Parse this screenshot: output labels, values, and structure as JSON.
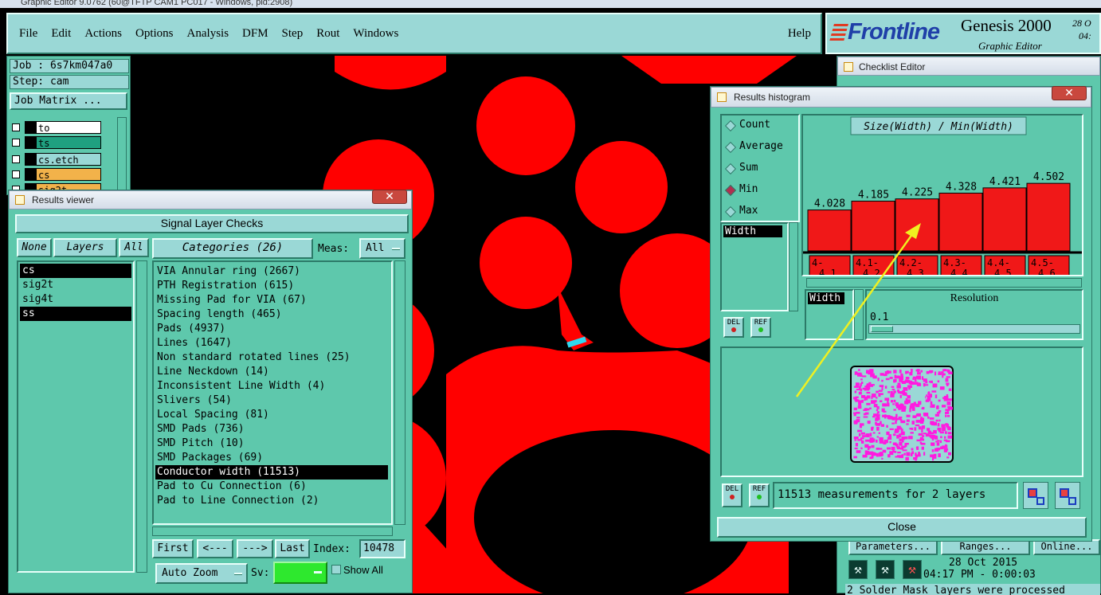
{
  "titlebar": {
    "text": "Graphic Editor 9.0762 (60@TFTP CAM1 PC017 - Windows, pid:2908)"
  },
  "menu": {
    "items": [
      "File",
      "Edit",
      "Actions",
      "Options",
      "Analysis",
      "DFM",
      "Step",
      "Rout",
      "Windows"
    ],
    "help": "Help"
  },
  "brand": {
    "logo": "Frontline",
    "product": "Genesis 2000",
    "subtitle": "Graphic Editor",
    "date_partial": "28 O",
    "time_partial": "04:"
  },
  "job": {
    "job": "Job : 6s7km047a0",
    "step": "Step: cam",
    "job_matrix": "Job Matrix ..."
  },
  "layers_panel": {
    "items": [
      {
        "name": "to",
        "color": "#ffffff"
      },
      {
        "name": "ts",
        "color": "#1fa080"
      },
      {
        "name": "cs.etch",
        "color": "#9ad8d6"
      },
      {
        "name": "cs",
        "color": "#f2b24a"
      },
      {
        "name": "sig2t",
        "color": "#f2b24a"
      }
    ]
  },
  "results_viewer": {
    "title": "Results viewer",
    "close": "✕",
    "header": "Signal Layer Checks",
    "none_btn": "None",
    "layers_label": "Layers",
    "all_btn": "All",
    "layers": [
      "cs",
      "sig2t",
      "sig4t",
      "ss"
    ],
    "selected_layers": [
      0,
      3
    ],
    "categories_label": "Categories (26)",
    "meas_label": "Meas:",
    "meas_value": "All",
    "categories": [
      "VIA Annular ring (2667)",
      "PTH Registration (615)",
      "Missing Pad for VIA (67)",
      "Spacing length (465)",
      "Pads (4937)",
      "Lines (1647)",
      "Non standard rotated lines (25)",
      "Line Neckdown (14)",
      "Inconsistent Line Width (4)",
      "Slivers (54)",
      "Local Spacing (81)",
      "SMD Pads (736)",
      "SMD Pitch (10)",
      "SMD Packages (69)",
      "Conductor width (11513)",
      "Pad to Cu Connection (6)",
      "Pad to Line Connection (2)"
    ],
    "selected_category": 14,
    "nav": {
      "first": "First",
      "prev": "<---",
      "next": "--->",
      "last": "Last",
      "index_label": "Index:",
      "index_value": "10478"
    },
    "auto_zoom": "Auto Zoom",
    "sv_label": "Sv:",
    "show_all": "Show All"
  },
  "checklist_editor": {
    "title": "Checklist Editor",
    "buttons": [
      "Parameters...",
      "Ranges...",
      "Online..."
    ],
    "date": "28 Oct 2015",
    "time": "04:17 PM - 0:00:03",
    "status": "2 Solder Mask layers were processed"
  },
  "histogram": {
    "title": "Results histogram",
    "close": "✕",
    "modes": [
      "Count",
      "Average",
      "Sum",
      "Min",
      "Max"
    ],
    "selected_mode": 3,
    "chart_title": "Size(Width) / Min(Width)",
    "attr_item": "Width",
    "del_label": "DEL",
    "ref_label": "REF",
    "resolution_label": "Resolution",
    "resolution_value": "0.1",
    "width_label": "Width",
    "summary": "11513 measurements for 2 layers",
    "close_label": "Close"
  },
  "chart_data": {
    "type": "bar",
    "title": "Size(Width) / Min(Width)",
    "categories": [
      "4-4.1",
      "4.1-4.2",
      "4.2-4.3",
      "4.3-4.4",
      "4.4-4.5",
      "4.5-4.6"
    ],
    "category_top": [
      "4-",
      "4.1-",
      "4.2-",
      "4.3-",
      "4.4-",
      "4.5-"
    ],
    "category_bottom": [
      "4.1",
      "4.2",
      "4.3",
      "4.4",
      "4.5",
      "4.6"
    ],
    "values": [
      4.028,
      4.185,
      4.225,
      4.328,
      4.421,
      4.502
    ],
    "labels": [
      "4.028",
      "4.185",
      "4.225",
      "4.328",
      "4.421",
      "4.502"
    ],
    "ylim": [
      0,
      5.0
    ],
    "bar_color": "#f01818"
  }
}
